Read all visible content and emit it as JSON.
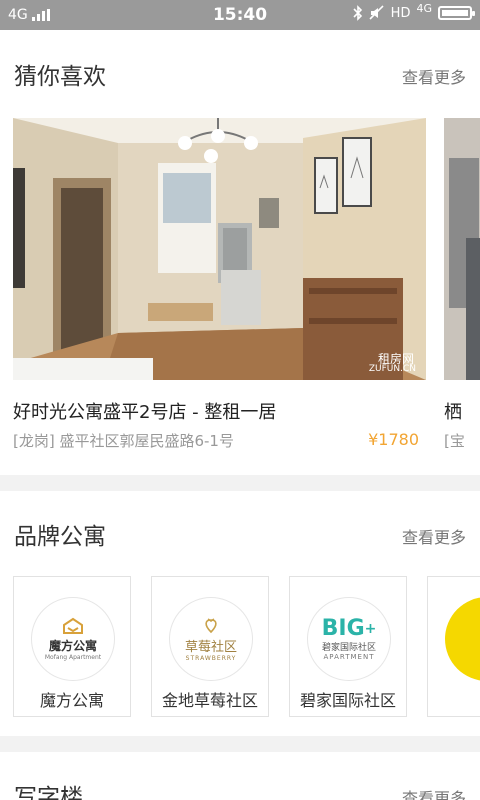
{
  "status_bar": {
    "network_left": "4G",
    "time": "15:40",
    "hd_label": "HD",
    "network_right": "4G",
    "battery_level": 0.9
  },
  "guess": {
    "title": "猜你喜欢",
    "more": "查看更多",
    "listings": [
      {
        "title": "好时光公寓盛平2号店 - 整租一居",
        "address": "[龙岗] 盛平社区郭屋民盛路6-1号",
        "price": "¥1780",
        "watermark_cn": "租房网",
        "watermark_en": "ZUFUN.CN"
      },
      {
        "title": "栖",
        "address": "[宝"
      }
    ]
  },
  "brand": {
    "title": "品牌公寓",
    "more": "查看更多",
    "items": [
      {
        "name": "魔方公寓",
        "logo_text": "魔方公寓",
        "logo_sub": "Mofang Apartment"
      },
      {
        "name": "金地草莓社区",
        "logo_text": "草莓社区",
        "logo_sub": "STRAWBERRY"
      },
      {
        "name": "碧家国际社区",
        "logo_big": "BIG",
        "logo_text": "碧家国际社区",
        "logo_sub": "APARTMENT"
      }
    ]
  },
  "office": {
    "title": "写字楼",
    "more": "查看更多"
  },
  "colors": {
    "price": "#f2a533",
    "big_logo_teal": "#2bb3a8",
    "strawberry_gold": "#c9a24a",
    "partial_yellow": "#f5d800"
  }
}
